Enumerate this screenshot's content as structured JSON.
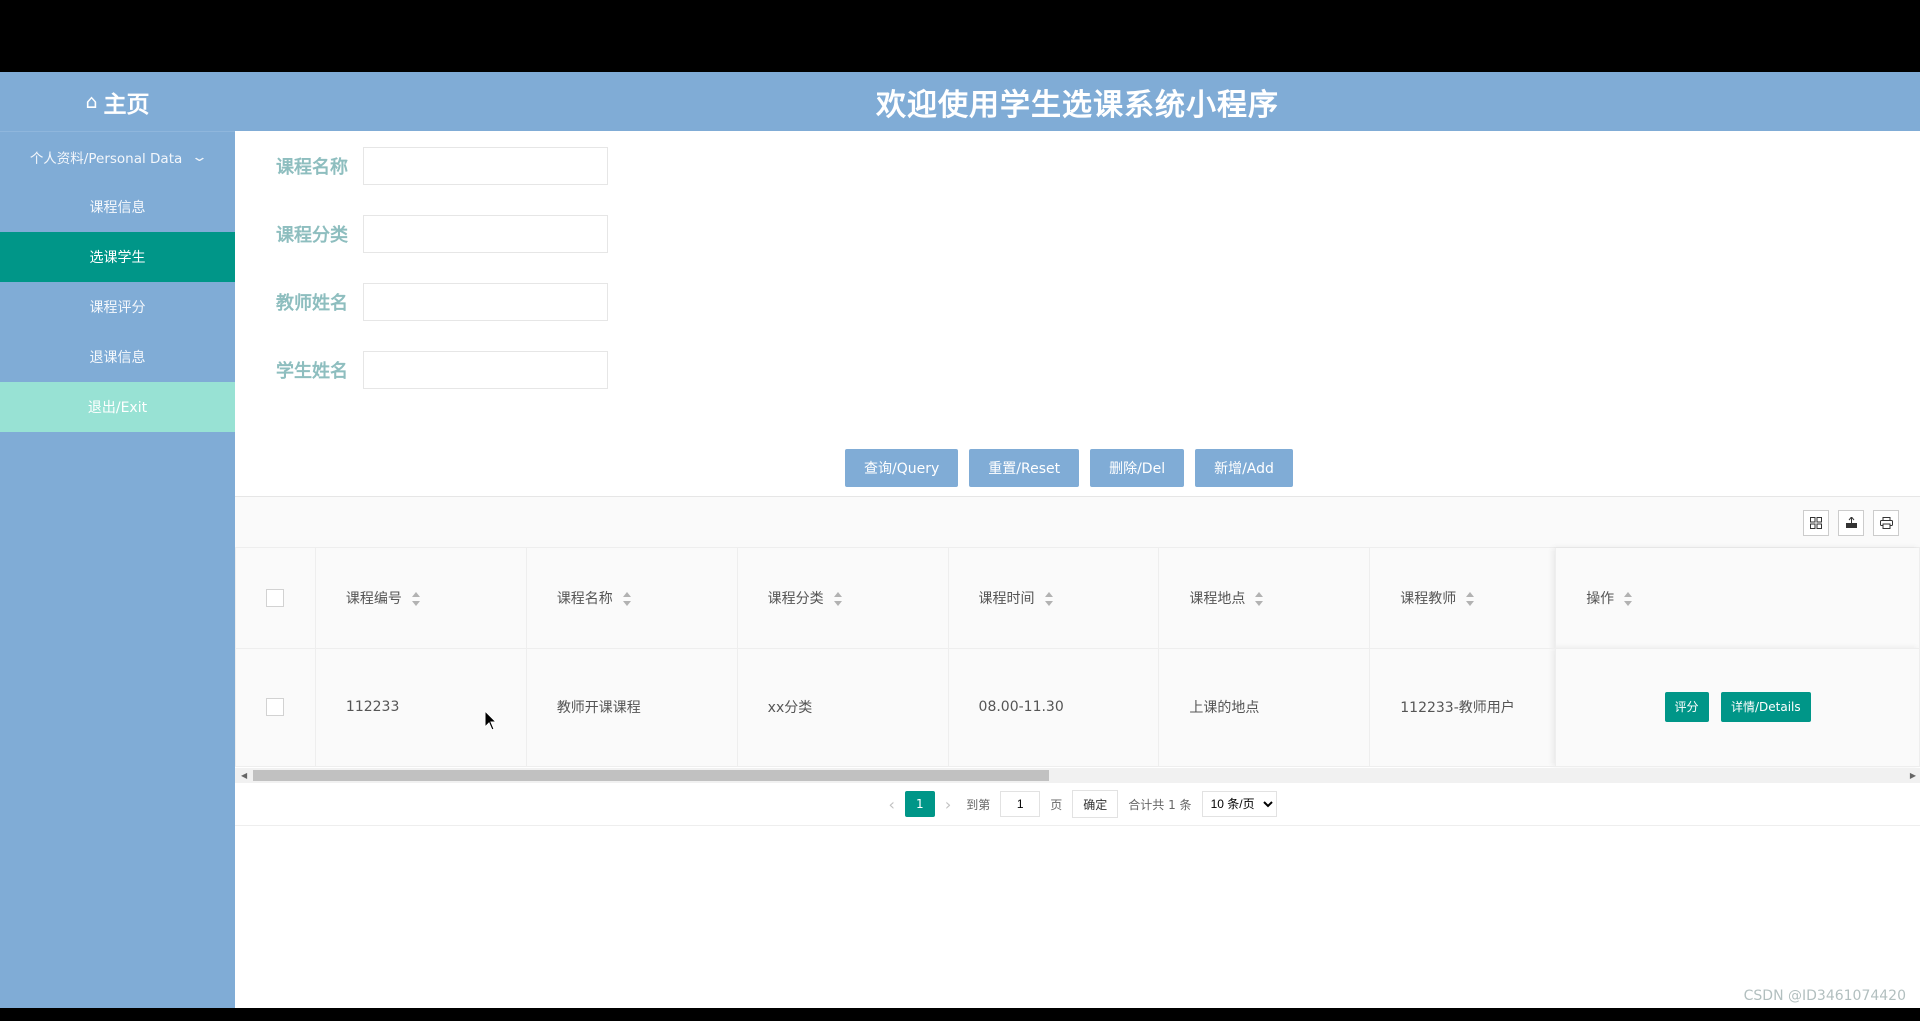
{
  "header": {
    "home_icon": "home-icon",
    "home_label": "主页",
    "title": "欢迎使用学生选课系统小程序"
  },
  "sidebar": {
    "group_label": "个人资料/Personal Data",
    "items": [
      {
        "label": "课程信息"
      },
      {
        "label": "选课学生",
        "active": true
      },
      {
        "label": "课程评分"
      },
      {
        "label": "退课信息"
      },
      {
        "label": "退出/Exit"
      }
    ]
  },
  "search": {
    "fields": [
      {
        "label": "课程名称",
        "value": ""
      },
      {
        "label": "课程分类",
        "value": ""
      },
      {
        "label": "教师姓名",
        "value": ""
      },
      {
        "label": "学生姓名",
        "value": ""
      }
    ],
    "buttons": {
      "query": "查询/Query",
      "reset": "重置/Reset",
      "delete": "删除/Del",
      "add": "新增/Add"
    }
  },
  "table": {
    "toolbar_icons": [
      "columns-filter-icon",
      "export-icon",
      "print-icon"
    ],
    "columns": [
      "课程编号",
      "课程名称",
      "课程分类",
      "课程时间",
      "课程地点",
      "课程教师",
      "操作"
    ],
    "rows": [
      {
        "course_no": "112233",
        "course_name": "教师开课课程",
        "category": "xx分类",
        "time": "08.00-11.30",
        "location": "上课的地点",
        "teacher": "112233-教师用户",
        "actions": {
          "rate": "评分",
          "details": "详情/Details"
        }
      }
    ]
  },
  "pagination": {
    "current_page": "1",
    "goto_label": "到第",
    "goto_value": "1",
    "page_unit": "页",
    "confirm": "确定",
    "total_text": "合计共 1 条",
    "page_size": "10 条/页"
  },
  "watermark": "CSDN @ID3461074420",
  "colors": {
    "header_bg": "#80acd6",
    "active_menu": "#009688",
    "exit_menu": "#98e2d4",
    "label_text": "#8ebebf"
  }
}
